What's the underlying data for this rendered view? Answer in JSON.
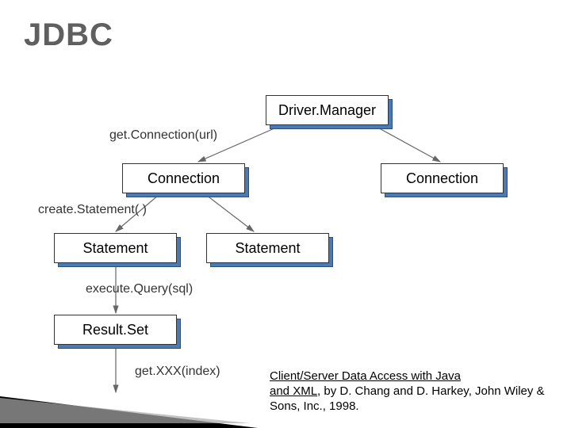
{
  "title": "JDBC",
  "nodes": {
    "driverManager": "Driver.Manager",
    "connection1": "Connection",
    "connection2": "Connection",
    "statement1": "Statement",
    "statement2": "Statement",
    "resultSet": "Result.Set"
  },
  "labels": {
    "getConnection": "get.Connection(url)",
    "createStatement": "create.Statement( )",
    "executeQuery": "execute.Query(sql)",
    "getXXX": "get.XXX(index)"
  },
  "citation": {
    "titleLine": "Client/Server Data Access with Java",
    "andXml": " and XML",
    "rest": ", by D. Chang and D. Harkey, John Wiley & Sons, Inc., 1998."
  }
}
